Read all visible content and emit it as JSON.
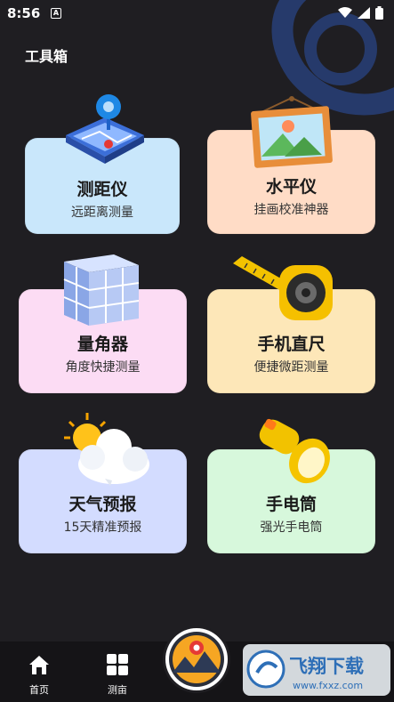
{
  "status": {
    "time": "8:56",
    "notif": "A"
  },
  "page": {
    "title": "工具箱"
  },
  "tools": [
    {
      "name": "测距仪",
      "desc": "远距离测量",
      "color": "#c9e7fb",
      "icon": "map-pin-icon"
    },
    {
      "name": "水平仪",
      "desc": "挂画校准神器",
      "color": "#ffdcc6",
      "icon": "picture-frame-icon"
    },
    {
      "name": "量角器",
      "desc": "角度快捷测量",
      "color": "#fcdcf4",
      "icon": "cube-icon"
    },
    {
      "name": "手机直尺",
      "desc": "便捷微距测量",
      "color": "#fde7b8",
      "icon": "tape-measure-icon"
    },
    {
      "name": "天气预报",
      "desc": "15天精准预报",
      "color": "#d3dcff",
      "icon": "weather-icon"
    },
    {
      "name": "手电筒",
      "desc": "强光手电筒",
      "color": "#d7f8dc",
      "icon": "flashlight-icon"
    }
  ],
  "tabs": [
    {
      "label": "首页",
      "icon": "home-icon"
    },
    {
      "label": "测亩",
      "icon": "grid-icon"
    }
  ],
  "watermark": {
    "brand": "飞翔下载",
    "url": "www.fxxz.com"
  }
}
